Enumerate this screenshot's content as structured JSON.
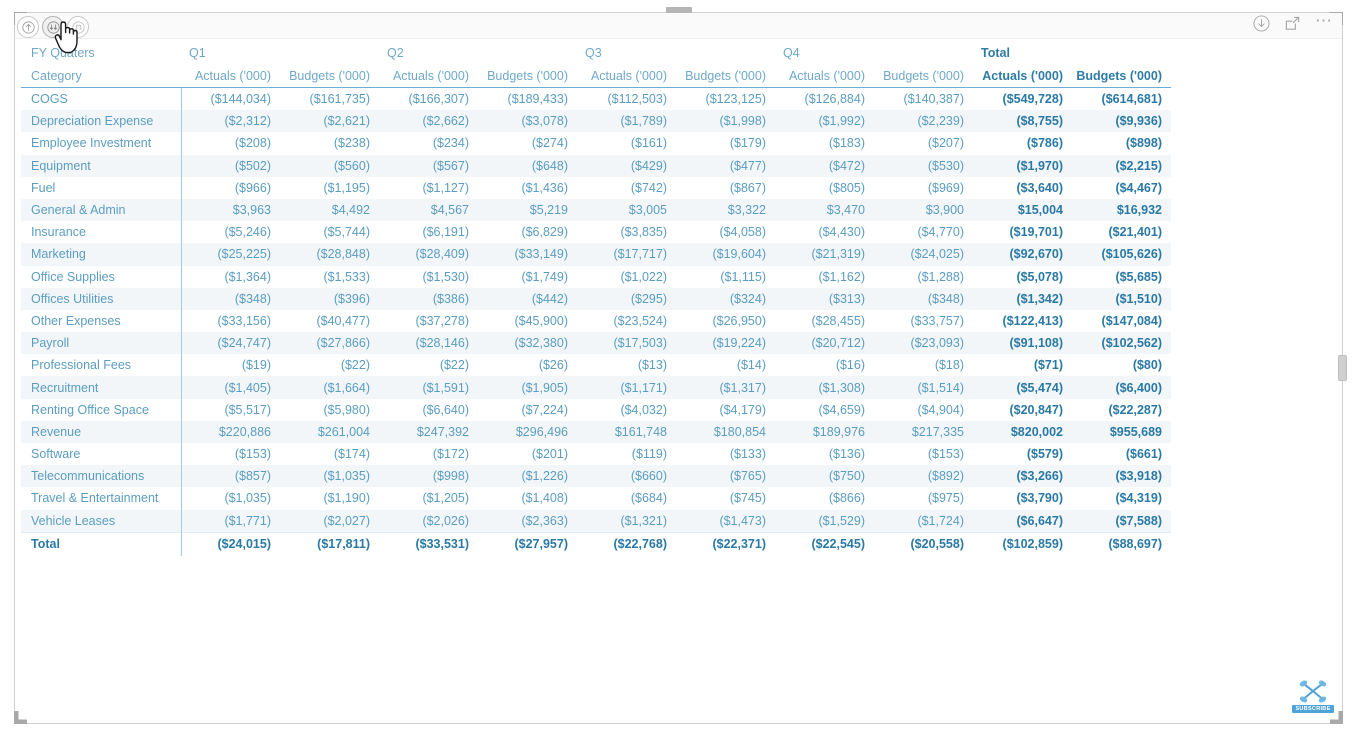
{
  "toolbar": {
    "drill_up_label": "Drill up",
    "drill_down_label": "Go to next level in hierarchy",
    "expand_label": "Expand all down one level in the hierarchy",
    "download_label": "Download",
    "focus_label": "Focus mode",
    "more_label": "More options",
    "more_glyph": "⋯"
  },
  "icons": {
    "drill_up": "arrow-up-circle-icon",
    "drill_down": "double-arrow-down-circle-icon",
    "expand_all": "expand-hierarchy-circle-icon",
    "download": "download-circle-icon",
    "focus": "focus-mode-icon",
    "more": "ellipsis-icon",
    "cursor": "hand-pointer-cursor",
    "subscribe": "subscribe-helix-icon"
  },
  "watermark": {
    "label": "SUBSCRIBE"
  },
  "colors": {
    "accent": "#6ab0d6",
    "header_text": "#6fa8c8",
    "total_text": "#2a79a4",
    "body_text": "#5b9dc0",
    "row_stripe": "#f2f6f9",
    "divider": "#9fcde4"
  },
  "matrix": {
    "row_header_top": "FY Quaters",
    "row_header_bottom": "Category",
    "quarter_groups": [
      {
        "label": "Q1",
        "total": false
      },
      {
        "label": "Q2",
        "total": false
      },
      {
        "label": "Q3",
        "total": false
      },
      {
        "label": "Q4",
        "total": false
      },
      {
        "label": "Total",
        "total": true
      }
    ],
    "measures": [
      "Actuals ('000)",
      "Budgets ('000)"
    ],
    "measure_headers": [
      {
        "label": "Actuals ('000)",
        "total": false
      },
      {
        "label": "Budgets ('000)",
        "total": false
      },
      {
        "label": "Actuals ('000)",
        "total": false
      },
      {
        "label": "Budgets ('000)",
        "total": false
      },
      {
        "label": "Actuals ('000)",
        "total": false
      },
      {
        "label": "Budgets ('000)",
        "total": false
      },
      {
        "label": "Actuals ('000)",
        "total": false
      },
      {
        "label": "Budgets ('000)",
        "total": false
      },
      {
        "label": "Actuals ('000)",
        "total": true
      },
      {
        "label": "Budgets ('000)",
        "total": true
      }
    ],
    "rows": [
      {
        "category": "COGS",
        "values": [
          "($144,034)",
          "($161,735)",
          "($166,307)",
          "($189,433)",
          "($112,503)",
          "($123,125)",
          "($126,884)",
          "($140,387)",
          "($549,728)",
          "($614,681)"
        ]
      },
      {
        "category": "Depreciation Expense",
        "values": [
          "($2,312)",
          "($2,621)",
          "($2,662)",
          "($3,078)",
          "($1,789)",
          "($1,998)",
          "($1,992)",
          "($2,239)",
          "($8,755)",
          "($9,936)"
        ]
      },
      {
        "category": "Employee Investment",
        "values": [
          "($208)",
          "($238)",
          "($234)",
          "($274)",
          "($161)",
          "($179)",
          "($183)",
          "($207)",
          "($786)",
          "($898)"
        ]
      },
      {
        "category": "Equipment",
        "values": [
          "($502)",
          "($560)",
          "($567)",
          "($648)",
          "($429)",
          "($477)",
          "($472)",
          "($530)",
          "($1,970)",
          "($2,215)"
        ]
      },
      {
        "category": "Fuel",
        "values": [
          "($966)",
          "($1,195)",
          "($1,127)",
          "($1,436)",
          "($742)",
          "($867)",
          "($805)",
          "($969)",
          "($3,640)",
          "($4,467)"
        ]
      },
      {
        "category": "General & Admin",
        "values": [
          "$3,963",
          "$4,492",
          "$4,567",
          "$5,219",
          "$3,005",
          "$3,322",
          "$3,470",
          "$3,900",
          "$15,004",
          "$16,932"
        ]
      },
      {
        "category": "Insurance",
        "values": [
          "($5,246)",
          "($5,744)",
          "($6,191)",
          "($6,829)",
          "($3,835)",
          "($4,058)",
          "($4,430)",
          "($4,770)",
          "($19,701)",
          "($21,401)"
        ]
      },
      {
        "category": "Marketing",
        "values": [
          "($25,225)",
          "($28,848)",
          "($28,409)",
          "($33,149)",
          "($17,717)",
          "($19,604)",
          "($21,319)",
          "($24,025)",
          "($92,670)",
          "($105,626)"
        ]
      },
      {
        "category": "Office Supplies",
        "values": [
          "($1,364)",
          "($1,533)",
          "($1,530)",
          "($1,749)",
          "($1,022)",
          "($1,115)",
          "($1,162)",
          "($1,288)",
          "($5,078)",
          "($5,685)"
        ]
      },
      {
        "category": "Offices Utilities",
        "values": [
          "($348)",
          "($396)",
          "($386)",
          "($442)",
          "($295)",
          "($324)",
          "($313)",
          "($348)",
          "($1,342)",
          "($1,510)"
        ]
      },
      {
        "category": "Other Expenses",
        "values": [
          "($33,156)",
          "($40,477)",
          "($37,278)",
          "($45,900)",
          "($23,524)",
          "($26,950)",
          "($28,455)",
          "($33,757)",
          "($122,413)",
          "($147,084)"
        ]
      },
      {
        "category": "Payroll",
        "values": [
          "($24,747)",
          "($27,866)",
          "($28,146)",
          "($32,380)",
          "($17,503)",
          "($19,224)",
          "($20,712)",
          "($23,093)",
          "($91,108)",
          "($102,562)"
        ]
      },
      {
        "category": "Professional Fees",
        "values": [
          "($19)",
          "($22)",
          "($22)",
          "($26)",
          "($13)",
          "($14)",
          "($16)",
          "($18)",
          "($71)",
          "($80)"
        ]
      },
      {
        "category": "Recruitment",
        "values": [
          "($1,405)",
          "($1,664)",
          "($1,591)",
          "($1,905)",
          "($1,171)",
          "($1,317)",
          "($1,308)",
          "($1,514)",
          "($5,474)",
          "($6,400)"
        ]
      },
      {
        "category": "Renting Office Space",
        "values": [
          "($5,517)",
          "($5,980)",
          "($6,640)",
          "($7,224)",
          "($4,032)",
          "($4,179)",
          "($4,659)",
          "($4,904)",
          "($20,847)",
          "($22,287)"
        ]
      },
      {
        "category": "Revenue",
        "values": [
          "$220,886",
          "$261,004",
          "$247,392",
          "$296,496",
          "$161,748",
          "$180,854",
          "$189,976",
          "$217,335",
          "$820,002",
          "$955,689"
        ]
      },
      {
        "category": "Software",
        "values": [
          "($153)",
          "($174)",
          "($172)",
          "($201)",
          "($119)",
          "($133)",
          "($136)",
          "($153)",
          "($579)",
          "($661)"
        ]
      },
      {
        "category": "Telecommunications",
        "values": [
          "($857)",
          "($1,035)",
          "($998)",
          "($1,226)",
          "($660)",
          "($765)",
          "($750)",
          "($892)",
          "($3,266)",
          "($3,918)"
        ]
      },
      {
        "category": "Travel & Entertainment",
        "values": [
          "($1,035)",
          "($1,190)",
          "($1,205)",
          "($1,408)",
          "($684)",
          "($745)",
          "($866)",
          "($975)",
          "($3,790)",
          "($4,319)"
        ]
      },
      {
        "category": "Vehicle Leases",
        "values": [
          "($1,771)",
          "($2,027)",
          "($2,026)",
          "($2,363)",
          "($1,321)",
          "($1,473)",
          "($1,529)",
          "($1,724)",
          "($6,647)",
          "($7,588)"
        ]
      }
    ],
    "total_row": {
      "category": "Total",
      "values": [
        "($24,015)",
        "($17,811)",
        "($33,531)",
        "($27,957)",
        "($22,768)",
        "($22,371)",
        "($22,545)",
        "($20,558)",
        "($102,859)",
        "($88,697)"
      ]
    }
  }
}
